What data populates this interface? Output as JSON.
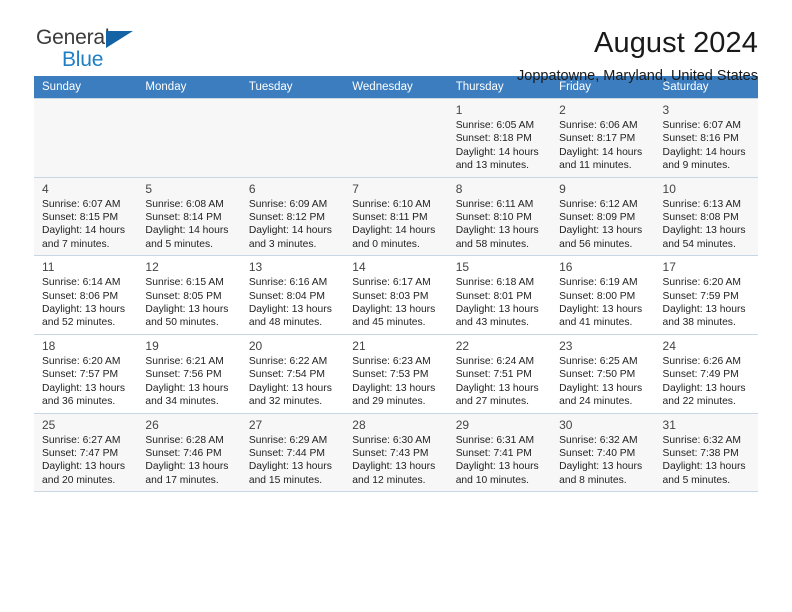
{
  "brand": {
    "name_top": "General",
    "name_bottom": "Blue",
    "accent_color": "#1f7ec4",
    "triangle_color": "#1464a5"
  },
  "header": {
    "title": "August 2024",
    "subtitle": "Joppatowne, Maryland, United States"
  },
  "calendar": {
    "header_bg": "#3b7dbf",
    "weekdays": [
      "Sunday",
      "Monday",
      "Tuesday",
      "Wednesday",
      "Thursday",
      "Friday",
      "Saturday"
    ],
    "weeks": [
      [
        {
          "day": "",
          "detail": ""
        },
        {
          "day": "",
          "detail": ""
        },
        {
          "day": "",
          "detail": ""
        },
        {
          "day": "",
          "detail": ""
        },
        {
          "day": "1",
          "detail": "Sunrise: 6:05 AM\nSunset: 8:18 PM\nDaylight: 14 hours\nand 13 minutes."
        },
        {
          "day": "2",
          "detail": "Sunrise: 6:06 AM\nSunset: 8:17 PM\nDaylight: 14 hours\nand 11 minutes."
        },
        {
          "day": "3",
          "detail": "Sunrise: 6:07 AM\nSunset: 8:16 PM\nDaylight: 14 hours\nand 9 minutes."
        }
      ],
      [
        {
          "day": "4",
          "detail": "Sunrise: 6:07 AM\nSunset: 8:15 PM\nDaylight: 14 hours\nand 7 minutes."
        },
        {
          "day": "5",
          "detail": "Sunrise: 6:08 AM\nSunset: 8:14 PM\nDaylight: 14 hours\nand 5 minutes."
        },
        {
          "day": "6",
          "detail": "Sunrise: 6:09 AM\nSunset: 8:12 PM\nDaylight: 14 hours\nand 3 minutes."
        },
        {
          "day": "7",
          "detail": "Sunrise: 6:10 AM\nSunset: 8:11 PM\nDaylight: 14 hours\nand 0 minutes."
        },
        {
          "day": "8",
          "detail": "Sunrise: 6:11 AM\nSunset: 8:10 PM\nDaylight: 13 hours\nand 58 minutes."
        },
        {
          "day": "9",
          "detail": "Sunrise: 6:12 AM\nSunset: 8:09 PM\nDaylight: 13 hours\nand 56 minutes."
        },
        {
          "day": "10",
          "detail": "Sunrise: 6:13 AM\nSunset: 8:08 PM\nDaylight: 13 hours\nand 54 minutes."
        }
      ],
      [
        {
          "day": "11",
          "detail": "Sunrise: 6:14 AM\nSunset: 8:06 PM\nDaylight: 13 hours\nand 52 minutes."
        },
        {
          "day": "12",
          "detail": "Sunrise: 6:15 AM\nSunset: 8:05 PM\nDaylight: 13 hours\nand 50 minutes."
        },
        {
          "day": "13",
          "detail": "Sunrise: 6:16 AM\nSunset: 8:04 PM\nDaylight: 13 hours\nand 48 minutes."
        },
        {
          "day": "14",
          "detail": "Sunrise: 6:17 AM\nSunset: 8:03 PM\nDaylight: 13 hours\nand 45 minutes."
        },
        {
          "day": "15",
          "detail": "Sunrise: 6:18 AM\nSunset: 8:01 PM\nDaylight: 13 hours\nand 43 minutes."
        },
        {
          "day": "16",
          "detail": "Sunrise: 6:19 AM\nSunset: 8:00 PM\nDaylight: 13 hours\nand 41 minutes."
        },
        {
          "day": "17",
          "detail": "Sunrise: 6:20 AM\nSunset: 7:59 PM\nDaylight: 13 hours\nand 38 minutes."
        }
      ],
      [
        {
          "day": "18",
          "detail": "Sunrise: 6:20 AM\nSunset: 7:57 PM\nDaylight: 13 hours\nand 36 minutes."
        },
        {
          "day": "19",
          "detail": "Sunrise: 6:21 AM\nSunset: 7:56 PM\nDaylight: 13 hours\nand 34 minutes."
        },
        {
          "day": "20",
          "detail": "Sunrise: 6:22 AM\nSunset: 7:54 PM\nDaylight: 13 hours\nand 32 minutes."
        },
        {
          "day": "21",
          "detail": "Sunrise: 6:23 AM\nSunset: 7:53 PM\nDaylight: 13 hours\nand 29 minutes."
        },
        {
          "day": "22",
          "detail": "Sunrise: 6:24 AM\nSunset: 7:51 PM\nDaylight: 13 hours\nand 27 minutes."
        },
        {
          "day": "23",
          "detail": "Sunrise: 6:25 AM\nSunset: 7:50 PM\nDaylight: 13 hours\nand 24 minutes."
        },
        {
          "day": "24",
          "detail": "Sunrise: 6:26 AM\nSunset: 7:49 PM\nDaylight: 13 hours\nand 22 minutes."
        }
      ],
      [
        {
          "day": "25",
          "detail": "Sunrise: 6:27 AM\nSunset: 7:47 PM\nDaylight: 13 hours\nand 20 minutes."
        },
        {
          "day": "26",
          "detail": "Sunrise: 6:28 AM\nSunset: 7:46 PM\nDaylight: 13 hours\nand 17 minutes."
        },
        {
          "day": "27",
          "detail": "Sunrise: 6:29 AM\nSunset: 7:44 PM\nDaylight: 13 hours\nand 15 minutes."
        },
        {
          "day": "28",
          "detail": "Sunrise: 6:30 AM\nSunset: 7:43 PM\nDaylight: 13 hours\nand 12 minutes."
        },
        {
          "day": "29",
          "detail": "Sunrise: 6:31 AM\nSunset: 7:41 PM\nDaylight: 13 hours\nand 10 minutes."
        },
        {
          "day": "30",
          "detail": "Sunrise: 6:32 AM\nSunset: 7:40 PM\nDaylight: 13 hours\nand 8 minutes."
        },
        {
          "day": "31",
          "detail": "Sunrise: 6:32 AM\nSunset: 7:38 PM\nDaylight: 13 hours\nand 5 minutes."
        }
      ]
    ]
  }
}
